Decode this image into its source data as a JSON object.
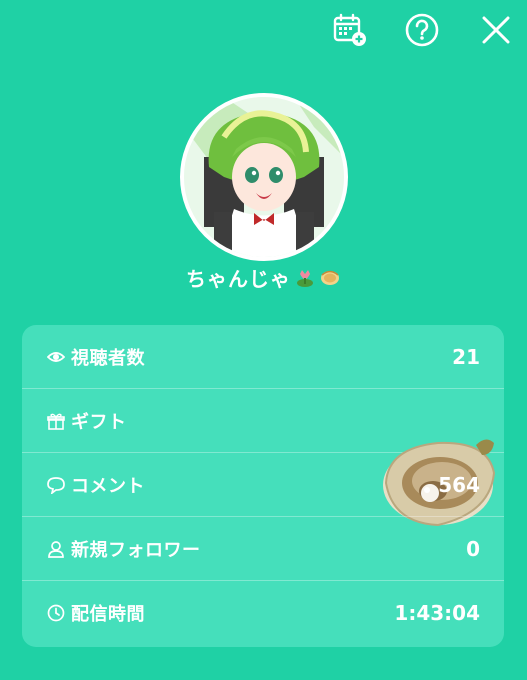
{
  "header": {
    "calendar_icon": "calendar-plus-icon",
    "help_icon": "help-circle-icon",
    "close_icon": "close-icon"
  },
  "profile": {
    "username": "ちゃんじゃ",
    "username_emojis": [
      "tulip-icon",
      "oyster-icon"
    ]
  },
  "stats": [
    {
      "icon": "eye-icon",
      "label": "視聴者数",
      "value": "21"
    },
    {
      "icon": "gift-icon",
      "label": "ギフト",
      "value": ""
    },
    {
      "icon": "comment-icon",
      "label": "コメント",
      "value": "564"
    },
    {
      "icon": "person-icon",
      "label": "新規フォロワー",
      "value": "0"
    },
    {
      "icon": "clock-icon",
      "label": "配信時間",
      "value": "1:43:04"
    }
  ],
  "colors": {
    "background": "#1fd1a5",
    "card": "#45dfbb",
    "text": "#ffffff"
  }
}
